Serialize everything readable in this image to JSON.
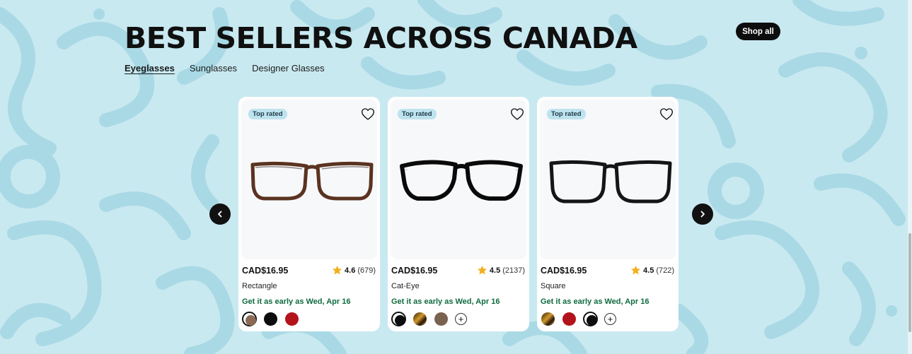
{
  "section": {
    "title": "BEST SELLERS ACROSS CANADA",
    "shop_all_label": "Shop all"
  },
  "tabs": [
    {
      "label": "Eyeglasses",
      "active": true
    },
    {
      "label": "Sunglasses",
      "active": false
    },
    {
      "label": "Designer Glasses",
      "active": false
    }
  ],
  "carousel": {
    "prev_icon": "chevron-left-icon",
    "next_icon": "chevron-right-icon"
  },
  "products": [
    {
      "badge": "Top rated",
      "price": "CAD$16.95",
      "rating": "4.6",
      "reviews": "(679)",
      "shape": "Rectangle",
      "delivery": "Get it as early as Wed, Apr 16",
      "frame_color": "#5a3320",
      "swatches": [
        {
          "color": "#8a6a55",
          "selected": true
        },
        {
          "color": "#0d0d0d",
          "selected": false
        },
        {
          "color": "#b3131b",
          "selected": false
        }
      ],
      "more_label": ""
    },
    {
      "badge": "Top rated",
      "price": "CAD$16.95",
      "rating": "4.5",
      "reviews": "(2137)",
      "shape": "Cat-Eye",
      "delivery": "Get it as early as Wed, Apr 16",
      "frame_color": "#0a0a0a",
      "swatches": [
        {
          "color": "#0d0d0d",
          "selected": true
        },
        {
          "color": "tortoise",
          "selected": false
        },
        {
          "color": "#7a6250",
          "selected": false
        }
      ],
      "more_label": "+"
    },
    {
      "badge": "Top rated",
      "price": "CAD$16.95",
      "rating": "4.5",
      "reviews": "(722)",
      "shape": "Square",
      "delivery": "Get it as early as Wed, Apr 16",
      "frame_color": "#151515",
      "swatches": [
        {
          "color": "tortoise",
          "selected": false
        },
        {
          "color": "#b3131b",
          "selected": false
        },
        {
          "color": "#0d0d0d",
          "selected": true
        }
      ],
      "more_label": "+"
    }
  ],
  "colors": {
    "background": "#c9e9f1",
    "pattern": "#a9d9e5",
    "star": "#f2b01e",
    "delivery_green": "#0f6b3f",
    "badge_bg": "#bde3ee"
  }
}
